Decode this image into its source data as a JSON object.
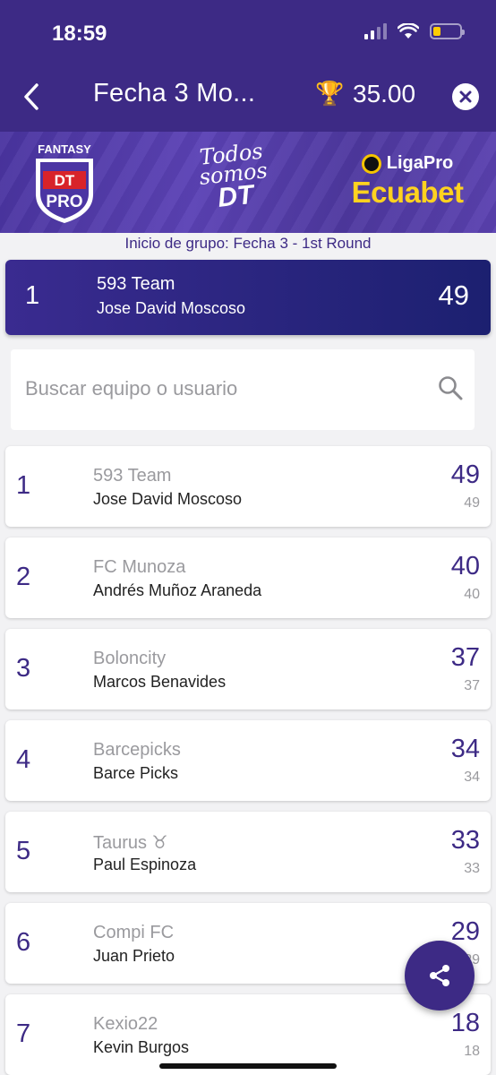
{
  "status_bar": {
    "time": "18:59"
  },
  "nav": {
    "title": "Fecha 3 Mo...",
    "points": "35.00",
    "trophy_icon": "trophy-icon"
  },
  "banner": {
    "logo_top": "FANTASY",
    "logo_dt": "DT",
    "logo_pro": "PRO",
    "slogan_line1": "Todos",
    "slogan_line2": "somos",
    "slogan_line3": "DT",
    "sponsor_top": "LigaPro",
    "sponsor_bottom": "Ecuabet"
  },
  "group_label": "Inicio de grupo: Fecha 3 - 1st Round",
  "leader": {
    "rank": "1",
    "team": "593 Team",
    "user": "Jose David Moscoso",
    "points": "49"
  },
  "search": {
    "placeholder": "Buscar equipo o usuario"
  },
  "rows": [
    {
      "rank": "1",
      "team": "593 Team",
      "user": "Jose David Moscoso",
      "points": "49",
      "sub": "49"
    },
    {
      "rank": "2",
      "team": "FC Munoza",
      "user": "Andrés  Muñoz Araneda",
      "points": "40",
      "sub": "40"
    },
    {
      "rank": "3",
      "team": "Boloncity",
      "user": "Marcos  Benavides",
      "points": "37",
      "sub": "37"
    },
    {
      "rank": "4",
      "team": "Barcepicks",
      "user": "Barce Picks",
      "points": "34",
      "sub": "34"
    },
    {
      "rank": "5",
      "team": "Taurus ♉",
      "user": "Paul Espinoza",
      "points": "33",
      "sub": "33"
    },
    {
      "rank": "6",
      "team": "Compi FC",
      "user": "Juan Prieto",
      "points": "29",
      "sub": "29"
    },
    {
      "rank": "7",
      "team": "Kexio22",
      "user": "Kevin Burgos",
      "points": "18",
      "sub": "18"
    }
  ],
  "colors": {
    "primary": "#3d2a85",
    "leader_gradient_end": "#1c2070",
    "sponsor_yellow": "#ffd21f"
  }
}
